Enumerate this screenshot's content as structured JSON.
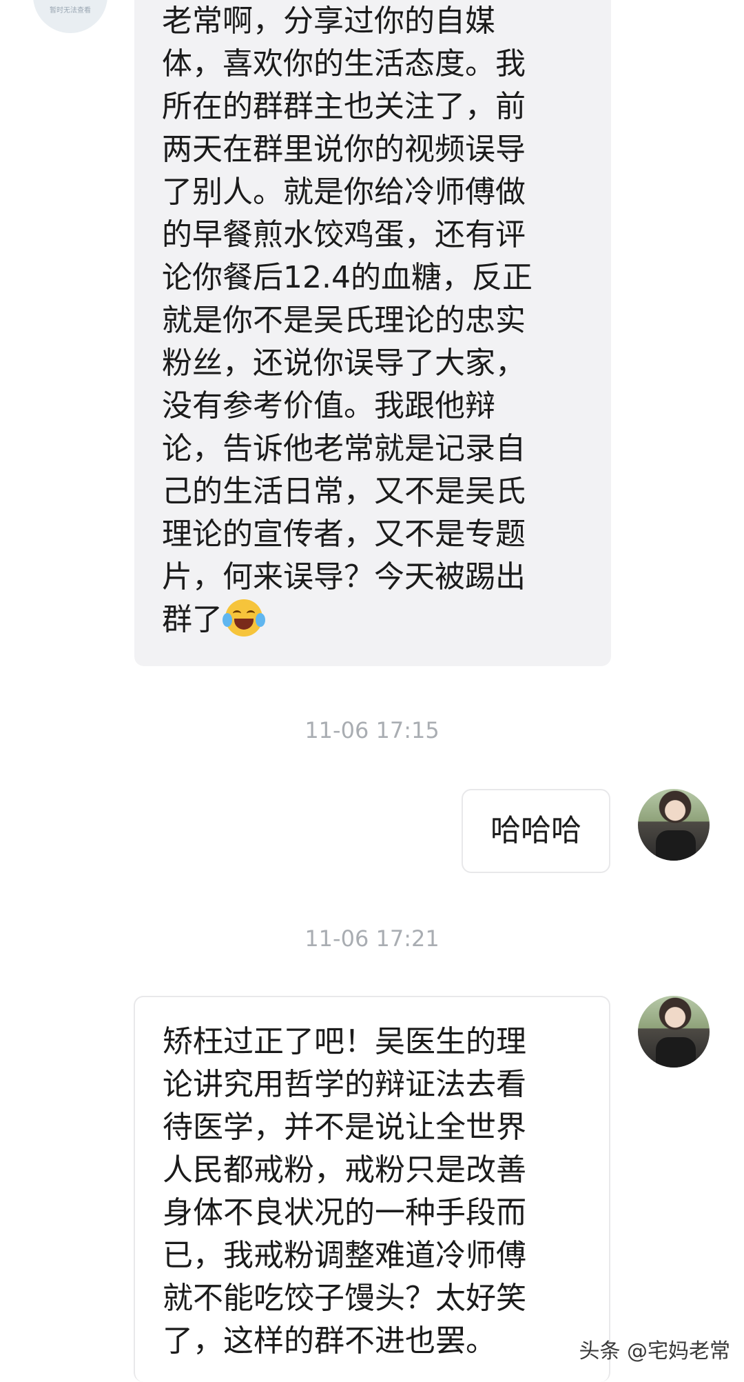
{
  "incoming_avatar": {
    "placeholder_text": "暂时无法查看"
  },
  "messages": {
    "incoming_text": "老常啊，分享过你的自媒\n体，喜欢你的生活态度。我\n所在的群群主也关注了，前\n两天在群里说你的视频误导\n了别人。就是你给冷师傅做\n的早餐煎水饺鸡蛋，还有评\n论你餐后12.4的血糖，反正\n就是你不是吴氏理论的忠实\n粉丝，还说你误导了大家，\n没有参考价值。我跟他辩\n论，告诉他老常就是记录自\n己的生活日常，又不是吴氏\n理论的宣传者，又不是专题\n片，何来误导？今天被踢出\n群了",
    "incoming_emoji": "tears-of-joy-emoji",
    "timestamp_1": "11-06 17:15",
    "reply_text": "哈哈哈",
    "timestamp_2": "11-06 17:21",
    "outgoing_text": "矫枉过正了吧！吴医生的理\n论讲究用哲学的辩证法去看\n待医学，并不是说让全世界\n人民都戒粉，戒粉只是改善\n身体不良状况的一种手段而\n已，我戒粉调整难道冷师傅\n就不能吃饺子馒头？太好笑\n了，这样的群不进也罢。"
  },
  "watermark": "头条 @宅妈老常"
}
